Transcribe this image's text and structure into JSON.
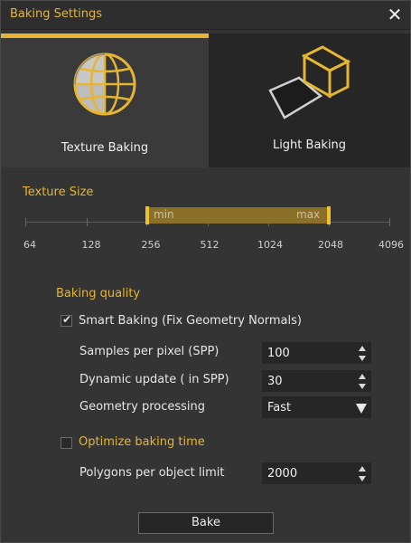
{
  "window": {
    "title": "Baking Settings"
  },
  "tabs": [
    {
      "label": "Texture Baking",
      "active": true
    },
    {
      "label": "Light Baking",
      "active": false
    }
  ],
  "texture_size": {
    "label": "Texture Size",
    "ticks": [
      "64",
      "128",
      "256",
      "512",
      "1024",
      "2048",
      "4096"
    ],
    "range_min_label": "min",
    "range_max_label": "max",
    "selected_min": "256",
    "selected_max": "2048"
  },
  "quality": {
    "header": "Baking quality",
    "smart_baking": {
      "label": "Smart Baking (Fix Geometry Normals)",
      "checked": true
    },
    "spp": {
      "label": "Samples per pixel (SPP)",
      "value": "100"
    },
    "dynamic_update": {
      "label": "Dynamic update ( in SPP)",
      "value": "30"
    },
    "geometry_processing": {
      "label": "Geometry processing",
      "value": "Fast"
    },
    "optimize": {
      "label": "Optimize baking time",
      "checked": false
    },
    "polygons_limit": {
      "label": "Polygons per object limit",
      "value": "2000"
    }
  },
  "actions": {
    "bake_label": "Bake"
  },
  "colors": {
    "accent": "#e6b532",
    "range_fill": "#8a7028",
    "background": "#343434",
    "field_background": "#262626"
  }
}
